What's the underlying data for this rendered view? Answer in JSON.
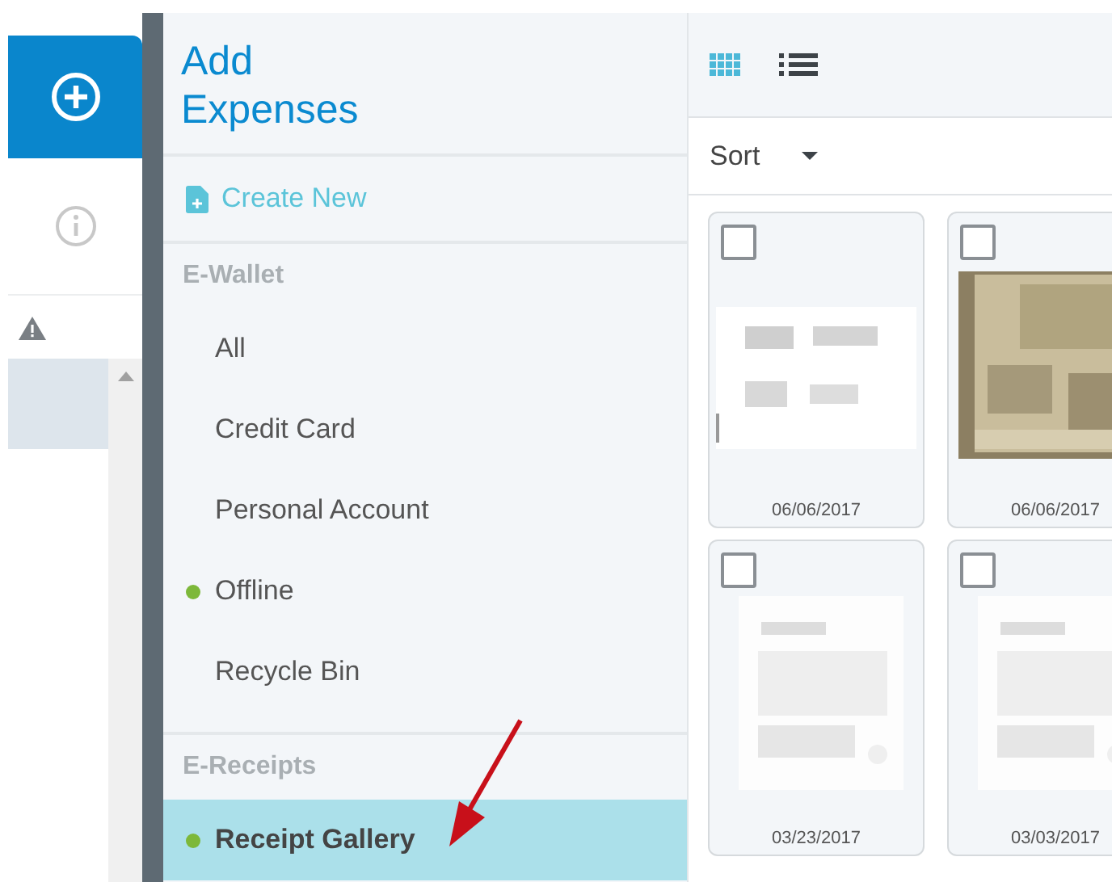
{
  "menu": {
    "title": "Add Expenses",
    "create_new": "Create New",
    "sections": [
      {
        "heading": "E-Wallet",
        "items": [
          {
            "label": "All",
            "selected": false,
            "marked": false
          },
          {
            "label": "Credit Card",
            "selected": false,
            "marked": false
          },
          {
            "label": "Personal Account",
            "selected": false,
            "marked": false
          },
          {
            "label": "Offline",
            "selected": false,
            "marked": true
          },
          {
            "label": "Recycle Bin",
            "selected": false,
            "marked": false
          }
        ]
      },
      {
        "heading": "E-Receipts",
        "items": [
          {
            "label": "Receipt Gallery",
            "selected": true,
            "marked": true
          }
        ]
      }
    ]
  },
  "views": [
    {
      "kind": "grid",
      "selected": true
    },
    {
      "kind": "list",
      "selected": false
    }
  ],
  "sort": {
    "label": "Sort"
  },
  "receipts": [
    {
      "date": "06/06/2017",
      "checked": false
    },
    {
      "date": "06/06/2017",
      "checked": false
    },
    {
      "date": "03/23/2017",
      "checked": false
    },
    {
      "date": "03/03/2017",
      "checked": false
    }
  ]
}
